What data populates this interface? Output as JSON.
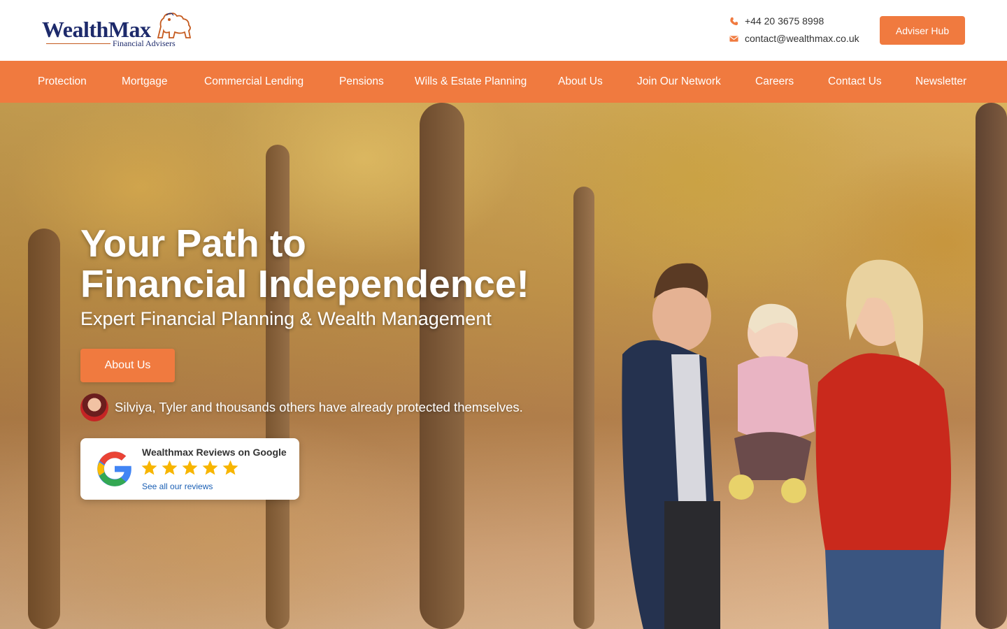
{
  "header": {
    "logo": {
      "brand": "WealthMax",
      "tagline": "Financial Advisers"
    },
    "phone": "+44 20 3675 8998",
    "email": "contact@wealthmax.co.uk",
    "adviser_button": "Adviser Hub"
  },
  "nav": {
    "items": [
      {
        "label": "Protection"
      },
      {
        "label": "Mortgage"
      },
      {
        "label": "Commercial Lending"
      },
      {
        "label": "Pensions"
      },
      {
        "label": "Wills & Estate Planning"
      },
      {
        "label": "About Us"
      },
      {
        "label": "Join Our Network"
      },
      {
        "label": "Careers"
      },
      {
        "label": "Contact Us"
      },
      {
        "label": "Newsletter"
      }
    ]
  },
  "hero": {
    "title_line1": "Your Path to",
    "title_line2": "Financial Independence!",
    "subtitle": "Expert Financial Planning & Wealth Management",
    "cta": "About Us",
    "testimonial": "Silviya, Tyler and thousands others have already protected themselves."
  },
  "reviews": {
    "title": "Wealthmax Reviews on Google",
    "rating": 5,
    "link": "See all our reviews"
  },
  "colors": {
    "accent": "#f07a3f",
    "brand_navy": "#1d2a6b",
    "star": "#f7b500",
    "link": "#1a5fb4"
  },
  "icons": [
    "phone-icon",
    "mail-icon",
    "google-logo-icon",
    "star-icon",
    "lion-crest-icon"
  ]
}
